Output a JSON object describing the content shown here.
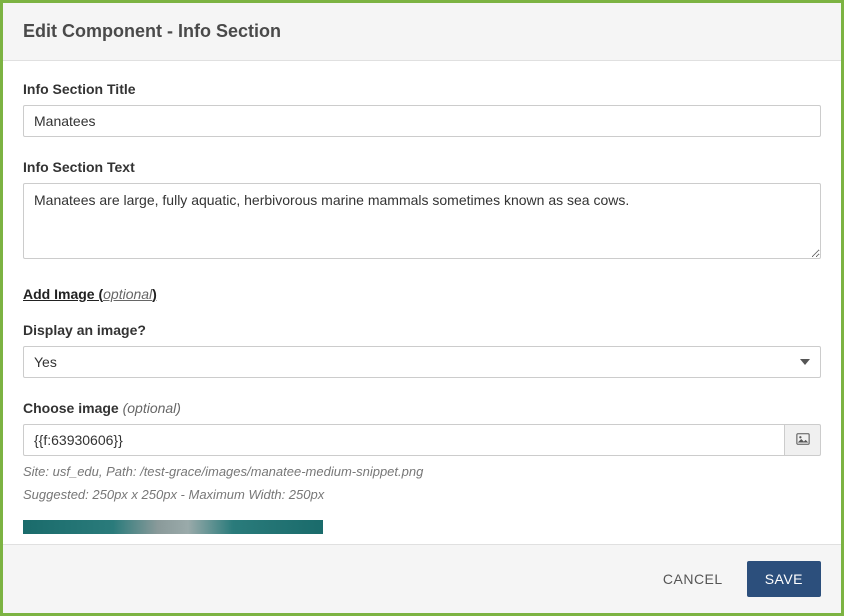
{
  "header": {
    "title": "Edit Component - Info Section"
  },
  "form": {
    "title_label": "Info Section Title",
    "title_value": "Manatees",
    "text_label": "Info Section Text",
    "text_value": "Manatees are large, fully aquatic, herbivorous marine mammals sometimes known as sea cows.",
    "add_image_heading": "Add Image (",
    "add_image_optional": "optional",
    "add_image_heading_close": ")",
    "display_image_label": "Display an image?",
    "display_image_value": "Yes",
    "choose_image_label": "Choose image ",
    "choose_image_optional": "(optional)",
    "choose_image_value": "{{f:63930606}}",
    "help_path": "Site: usf_edu, Path: /test-grace/images/manatee-medium-snippet.png",
    "help_suggested": "Suggested: 250px x 250px - Maximum Width: 250px"
  },
  "footer": {
    "cancel": "CANCEL",
    "save": "SAVE"
  }
}
